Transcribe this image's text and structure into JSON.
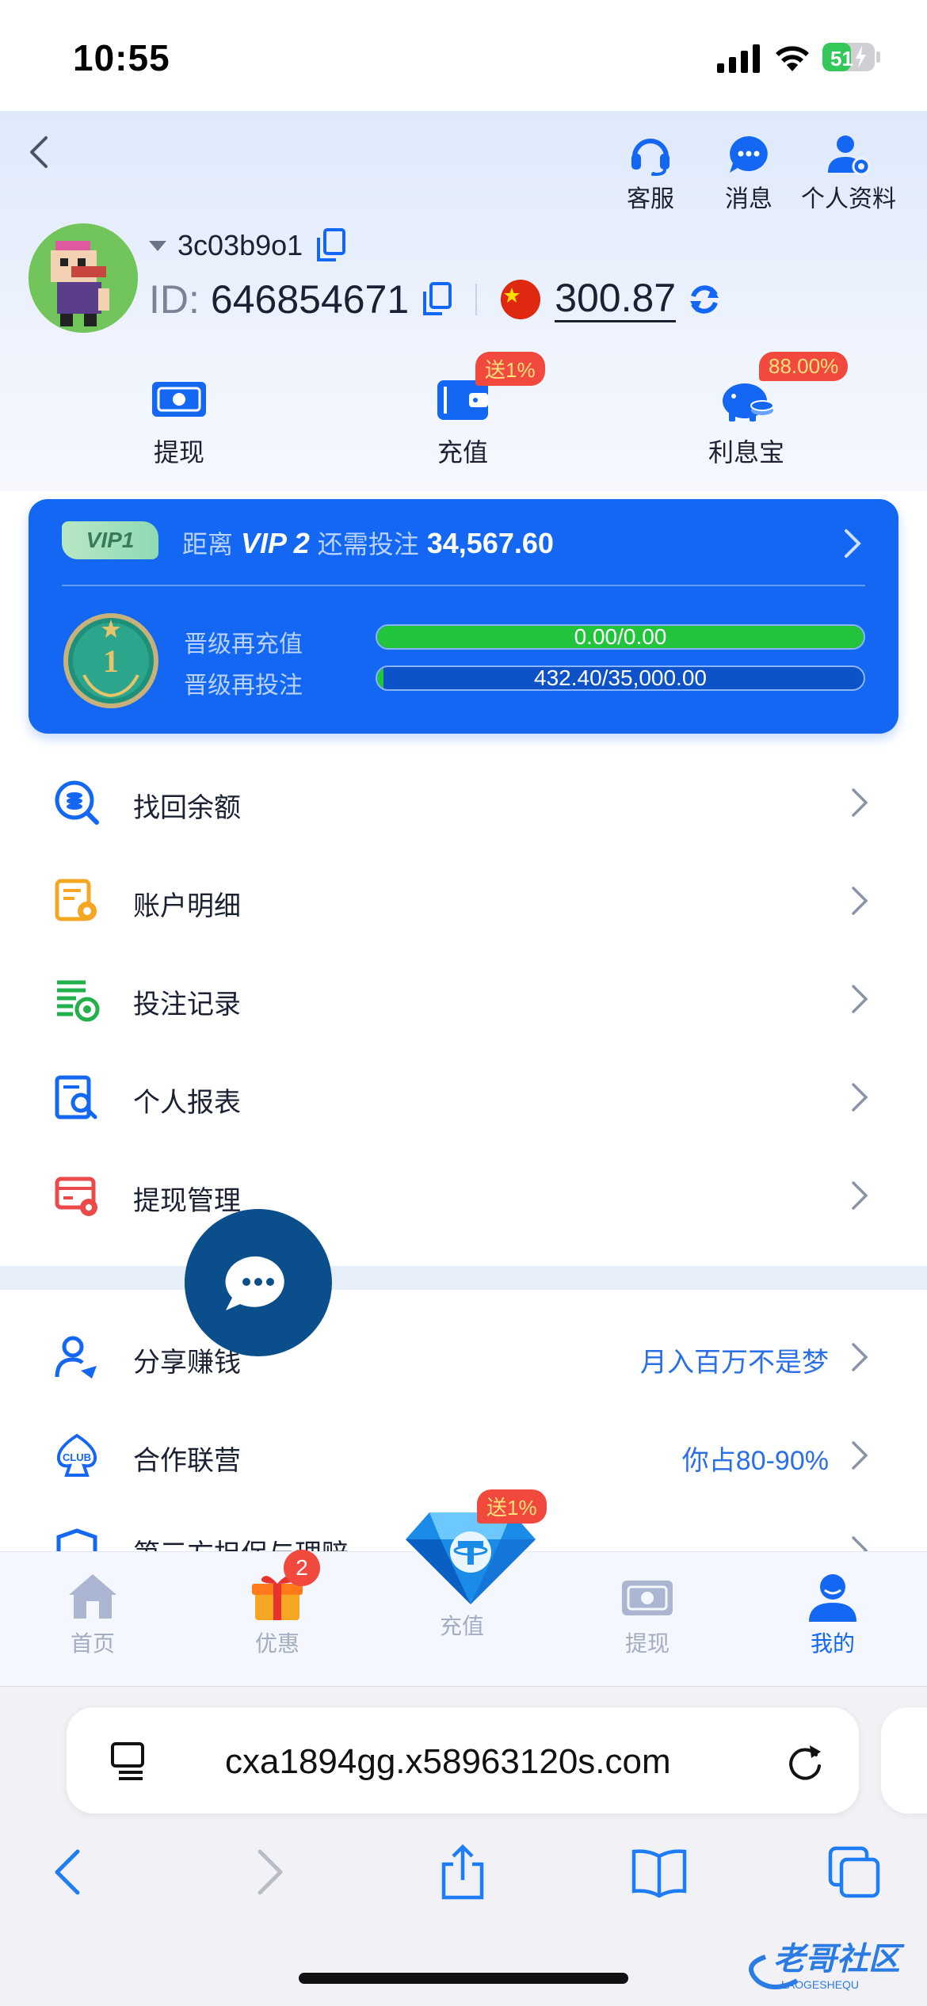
{
  "status": {
    "time": "10:55",
    "battery": "51"
  },
  "header": {
    "actions": [
      {
        "label": "客服",
        "icon": "headset-icon"
      },
      {
        "label": "消息",
        "icon": "chat-bubble-icon"
      },
      {
        "label": "个人资料",
        "icon": "user-settings-icon"
      }
    ],
    "username": "3c03b9o1",
    "id_label": "ID:",
    "id_value": "646854671",
    "balance": "300.87"
  },
  "quick_actions": [
    {
      "label": "提现",
      "icon": "cash-icon",
      "badge": ""
    },
    {
      "label": "充值",
      "icon": "wallet-icon",
      "badge": "送1%"
    },
    {
      "label": "利息宝",
      "icon": "piggy-bank-icon",
      "badge": "88.00%"
    }
  ],
  "vip": {
    "level_tag": "VIP1",
    "distance_prefix": "距离",
    "next_level": "VIP 2",
    "distance_mid": "还需投注",
    "distance_amount": "34,567.60",
    "medal_number": "1",
    "progress": [
      {
        "label": "晋级再充值",
        "text": "0.00/0.00",
        "fraction": 1.0
      },
      {
        "label": "晋级再投注",
        "text": "432.40/35,000.00",
        "fraction": 0.0124
      }
    ]
  },
  "menu": [
    {
      "label": "找回余额",
      "icon": "search-coins-icon",
      "right": ""
    },
    {
      "label": "账户明细",
      "icon": "account-detail-icon",
      "right": ""
    },
    {
      "label": "投注记录",
      "icon": "bet-record-icon",
      "right": ""
    },
    {
      "label": "个人报表",
      "icon": "report-search-icon",
      "right": ""
    },
    {
      "label": "提现管理",
      "icon": "withdraw-manage-icon",
      "right": ""
    },
    {
      "label": "分享赚钱",
      "icon": "share-user-icon",
      "right": "月入百万不是梦"
    },
    {
      "label": "合作联营",
      "icon": "club-icon",
      "right": "你占80-90%"
    },
    {
      "label": "第三方担保与理赔",
      "icon": "shield-icon",
      "right": ""
    }
  ],
  "tabbar": {
    "tabs": [
      {
        "label": "首页",
        "icon": "home-icon"
      },
      {
        "label": "优惠",
        "icon": "gift-icon"
      },
      {
        "label": "充值",
        "icon": "diamond-icon"
      },
      {
        "label": "提现",
        "icon": "cash-icon"
      },
      {
        "label": "我的",
        "icon": "user-icon"
      }
    ],
    "promo_badge": "2",
    "recharge_badge": "送1%"
  },
  "browser": {
    "url": "cxa1894gg.x58963120s.com"
  },
  "colors": {
    "primary": "#1367f3",
    "badge": "#f2493f",
    "progress_green": "#22c43c"
  }
}
